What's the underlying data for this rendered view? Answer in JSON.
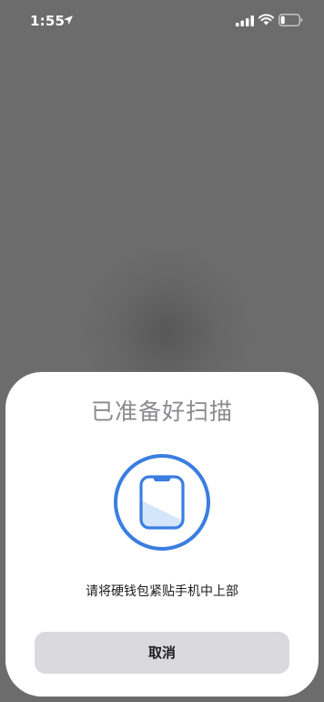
{
  "status_bar": {
    "time": "1:55",
    "location_icon": "location-arrow-icon",
    "signal_icon": "cellular-signal-icon",
    "wifi_icon": "wifi-icon",
    "battery_icon": "battery-icon"
  },
  "sheet": {
    "title": "已准备好扫描",
    "illustration_icon": "phone-scan-icon",
    "message": "请将硬钱包紧贴手机中上部",
    "cancel_label": "取消"
  },
  "colors": {
    "backdrop": "#6c6c6c",
    "sheet_background": "#ffffff",
    "accent": "#3a7ee0",
    "title_gray": "#8a8a8e",
    "button_background": "#d9d9de"
  }
}
